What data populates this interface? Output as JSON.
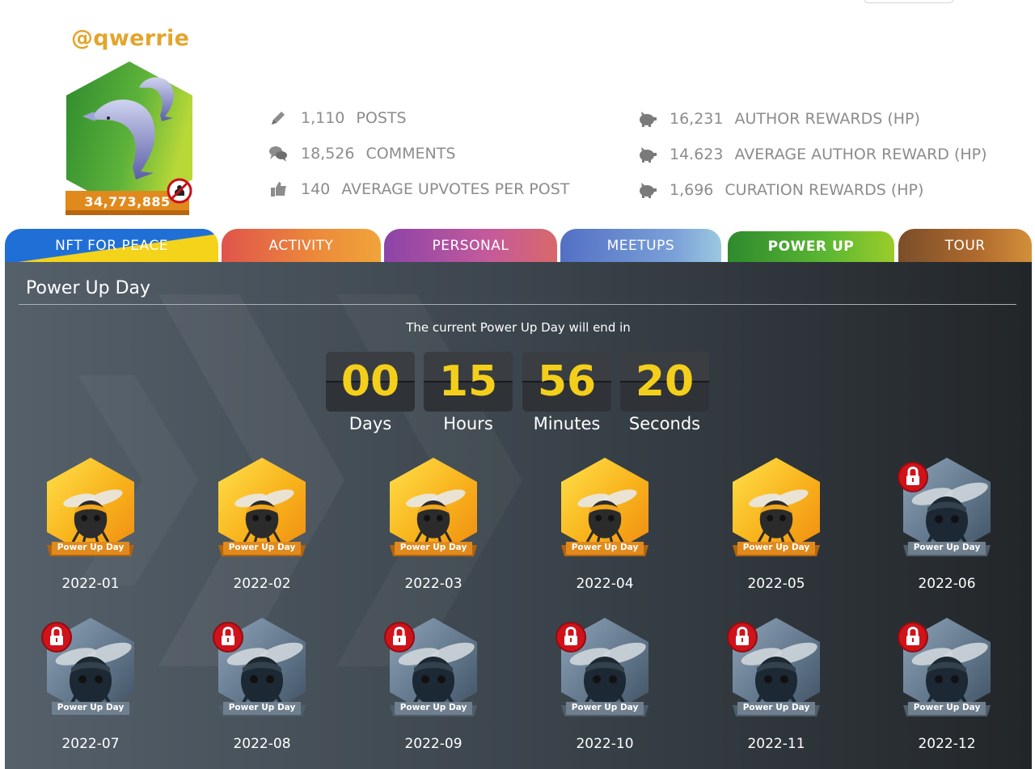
{
  "profile": {
    "username": "@qwerrie",
    "score": "34,773,885"
  },
  "stats_left": [
    {
      "icon": "pencil-icon",
      "value": "1,110",
      "label": "POSTS"
    },
    {
      "icon": "comments-icon",
      "value": "18,526",
      "label": "COMMENTS"
    },
    {
      "icon": "thumbs-up-icon",
      "value": "140",
      "label": "AVERAGE UPVOTES PER POST"
    }
  ],
  "stats_right": [
    {
      "icon": "piggy-bank-icon",
      "value": "16,231",
      "label": "AUTHOR REWARDS (HP)"
    },
    {
      "icon": "piggy-bank-icon",
      "value": "14.623",
      "label": "AVERAGE AUTHOR REWARD (HP)"
    },
    {
      "icon": "piggy-bank-icon",
      "value": "1,696",
      "label": "CURATION REWARDS (HP)"
    }
  ],
  "tabs": [
    {
      "label": "NFT FOR PEACE"
    },
    {
      "label": "ACTIVITY"
    },
    {
      "label": "PERSONAL"
    },
    {
      "label": "MEETUPS"
    },
    {
      "label": "POWER UP",
      "active": true
    },
    {
      "label": "TOUR"
    }
  ],
  "panel": {
    "title": "Power Up Day",
    "countdown_label": "The current Power Up Day will end in",
    "countdown": [
      {
        "value": "00",
        "unit": "Days"
      },
      {
        "value": "15",
        "unit": "Hours"
      },
      {
        "value": "56",
        "unit": "Minutes"
      },
      {
        "value": "20",
        "unit": "Seconds"
      }
    ]
  },
  "badges": [
    {
      "month": "2022-01",
      "ribbon": "Power Up Day",
      "unlocked": true
    },
    {
      "month": "2022-02",
      "ribbon": "Power Up Day",
      "unlocked": true
    },
    {
      "month": "2022-03",
      "ribbon": "Power Up Day",
      "unlocked": true
    },
    {
      "month": "2022-04",
      "ribbon": "Power Up Day",
      "unlocked": true
    },
    {
      "month": "2022-05",
      "ribbon": "Power Up Day",
      "unlocked": true
    },
    {
      "month": "2022-06",
      "ribbon": "Power Up Day",
      "unlocked": false
    },
    {
      "month": "2022-07",
      "ribbon": "Power Up Day",
      "unlocked": false
    },
    {
      "month": "2022-08",
      "ribbon": "Power Up Day",
      "unlocked": false
    },
    {
      "month": "2022-09",
      "ribbon": "Power Up Day",
      "unlocked": false
    },
    {
      "month": "2022-10",
      "ribbon": "Power Up Day",
      "unlocked": false
    },
    {
      "month": "2022-11",
      "ribbon": "Power Up Day",
      "unlocked": false
    },
    {
      "month": "2022-12",
      "ribbon": "Power Up Day",
      "unlocked": false
    }
  ],
  "colors": {
    "accent_username": "#e4a52c",
    "countdown_digits": "#f3cf1c",
    "score_ribbon": "#e08a1e",
    "lock_red": "#d0121b"
  }
}
